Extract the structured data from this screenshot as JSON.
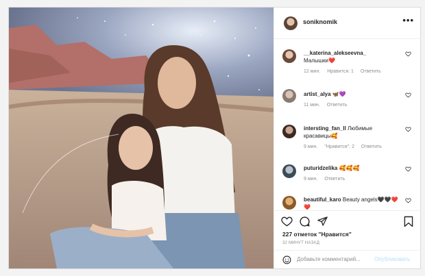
{
  "post": {
    "author": "soniknomik",
    "more_label": "•••",
    "comments": [
      {
        "user": "__katerina_alekseevna_",
        "text": "Малышки❤️",
        "time": "12 мин.",
        "likes": "Нравится: 1",
        "reply": "Ответить"
      },
      {
        "user": "artist_alya",
        "text": "🦋💜",
        "time": "11 мин.",
        "likes": "",
        "reply": "Ответить"
      },
      {
        "user": "intersting_fan_ll",
        "text": "Любимые красавицы🥰",
        "time": "9 мин.",
        "likes": "\"Нравится\": 2",
        "reply": "Ответить"
      },
      {
        "user": "puturidzelika",
        "text": "🥰🥰🥰",
        "time": "9 мин.",
        "likes": "",
        "reply": "Ответить"
      },
      {
        "user": "beautiful_karo",
        "text": "Beauty angels🖤🖤❤️❤️",
        "time": "",
        "likes": "",
        "reply": ""
      }
    ],
    "like_count": "227 отметок \"Нравится\"",
    "time_ago": "32 минут назад",
    "comment_placeholder": "Добавьте комментарий...",
    "post_button": "Опубликовать"
  },
  "icons": {
    "more": "more-icon",
    "heart": "heart-icon",
    "comment": "comment-icon",
    "share": "share-icon",
    "bookmark": "bookmark-icon",
    "emoji": "emoji-icon"
  },
  "colors": {
    "border": "#dbdbdb",
    "muted": "#8e8e8e",
    "post_button": "#b2dffc"
  }
}
